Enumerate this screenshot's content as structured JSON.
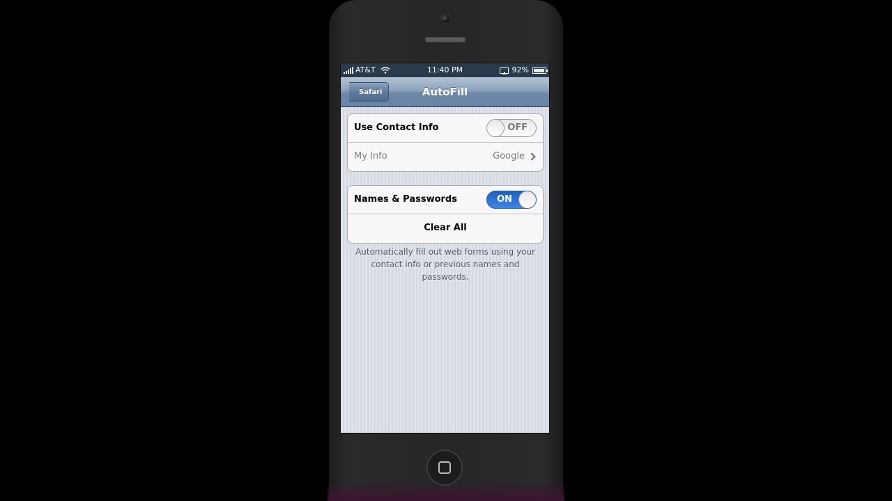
{
  "status_bar": {
    "carrier": "AT&T",
    "time": "11:40 PM",
    "battery": "92%",
    "battery_level": 0.92,
    "icons": [
      "signal-icon",
      "wifi-icon",
      "airplay-icon",
      "battery-icon"
    ]
  },
  "nav": {
    "title": "AutoFill",
    "back_label": "Safari"
  },
  "group1": {
    "contact_label": "Use Contact Info",
    "contact_switch": "OFF",
    "my_info_label": "My Info",
    "my_info_value": "Google"
  },
  "group2": {
    "passwords_label": "Names & Passwords",
    "passwords_switch": "ON",
    "clear_all_label": "Clear All"
  },
  "footer": {
    "text": "Automatically fill out web forms using your contact info or previous names and passwords."
  },
  "colors": {
    "nav_bar": "#7c95b4",
    "switch_on": "#2f75d8",
    "background": "#d9dde3"
  }
}
